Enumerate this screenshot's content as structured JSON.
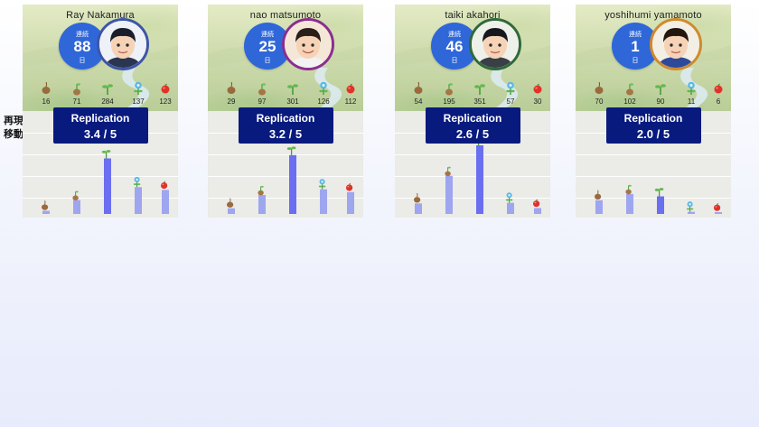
{
  "side_label": {
    "line1": "再現度",
    "line2": "移動平均"
  },
  "streak_label": "連続",
  "streak_unit": "日",
  "replication_label": "Replication",
  "colors": {
    "badge": "#081a7e",
    "streak": "#2f67d9",
    "bar_dark": "#6a6ef0",
    "bar_light": "#9ea6f0",
    "chart_bg": "#ebebe7"
  },
  "stage_icons": [
    "seed-icon",
    "sprout-icon",
    "seedling-icon",
    "blue-flower-icon",
    "red-fruit-icon"
  ],
  "users": [
    {
      "name": "Ray Nakamura",
      "streak_days": "88",
      "counts": [
        "16",
        "71",
        "284",
        "137",
        "123"
      ],
      "score": "3.4 / 5",
      "bars": [
        16,
        71,
        284,
        137,
        123
      ]
    },
    {
      "name": "nao matsumoto",
      "streak_days": "25",
      "counts": [
        "29",
        "97",
        "301",
        "126",
        "112"
      ],
      "score": "3.2 / 5",
      "bars": [
        29,
        97,
        301,
        126,
        112
      ]
    },
    {
      "name": "taiki akahori",
      "streak_days": "46",
      "counts": [
        "54",
        "195",
        "351",
        "57",
        "30"
      ],
      "score": "2.6 / 5",
      "bars": [
        54,
        195,
        351,
        57,
        30
      ]
    },
    {
      "name": "yoshihumi yamamoto",
      "streak_days": "1",
      "counts": [
        "70",
        "102",
        "90",
        "11",
        "6"
      ],
      "score": "2.0 / 5",
      "bars": [
        70,
        102,
        90,
        11,
        6
      ]
    }
  ]
}
